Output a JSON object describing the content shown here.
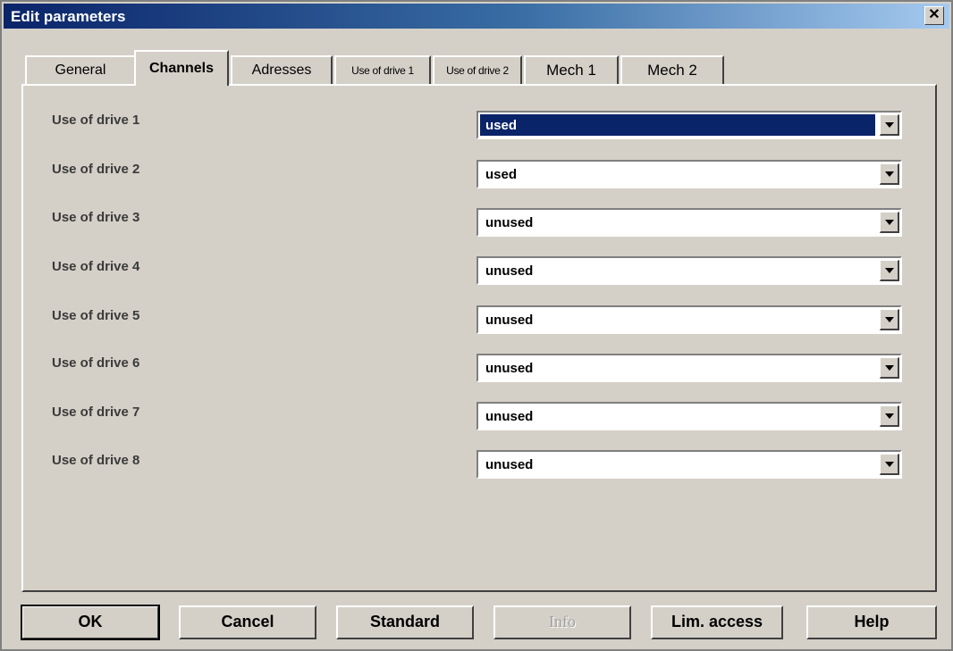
{
  "window": {
    "title": "Edit parameters",
    "close_label": "✕"
  },
  "tabs": [
    {
      "label": "General",
      "active": false
    },
    {
      "label": "Channels",
      "active": true
    },
    {
      "label": "Adresses",
      "active": false
    },
    {
      "label": "Use of drive 1",
      "active": false
    },
    {
      "label": "Use of drive 2",
      "active": false
    },
    {
      "label": "Mech 1",
      "active": false
    },
    {
      "label": "Mech 2",
      "active": false
    }
  ],
  "rows": [
    {
      "label": "Use of drive 1",
      "value": "used",
      "selected": true
    },
    {
      "label": "Use of drive 2",
      "value": "used",
      "selected": false
    },
    {
      "label": "Use of drive 3",
      "value": "unused",
      "selected": false
    },
    {
      "label": "Use of drive 4",
      "value": "unused",
      "selected": false
    },
    {
      "label": "Use of drive 5",
      "value": "unused",
      "selected": false
    },
    {
      "label": "Use of drive 6",
      "value": "unused",
      "selected": false
    },
    {
      "label": "Use of drive 7",
      "value": "unused",
      "selected": false
    },
    {
      "label": "Use of drive 8",
      "value": "unused",
      "selected": false
    }
  ],
  "buttons": {
    "ok": "OK",
    "cancel": "Cancel",
    "standard": "Standard",
    "info": "Info",
    "lim_access": "Lim. access",
    "help": "Help"
  },
  "colors": {
    "titlebar": "#0a246a",
    "selection": "#0a246a",
    "face": "#d4d0c8"
  }
}
